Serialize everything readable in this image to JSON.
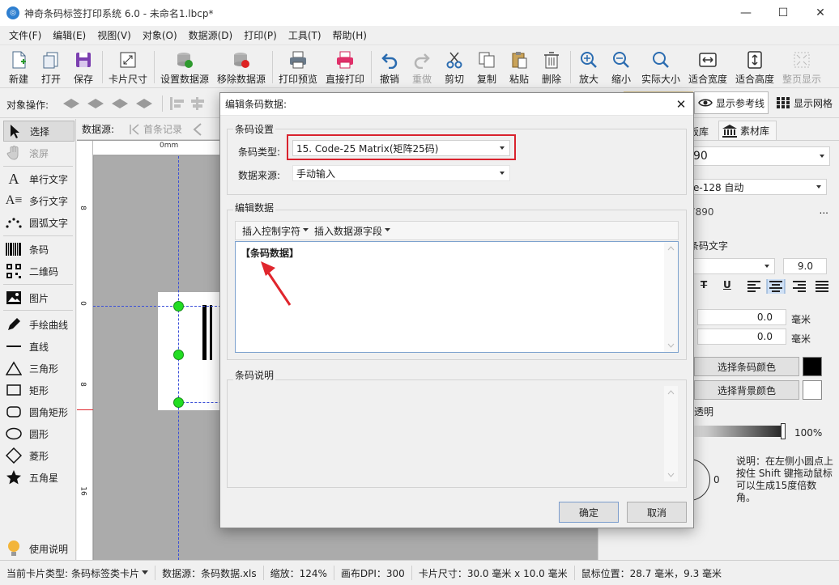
{
  "window": {
    "title": "神奇条码标签打印系统 6.0 - 未命名1.lbcp*",
    "minimize": "—",
    "maximize": "☐",
    "close": "✕"
  },
  "menu": [
    "文件(F)",
    "编辑(E)",
    "视图(V)",
    "对象(O)",
    "数据源(D)",
    "打印(P)",
    "工具(T)",
    "帮助(H)"
  ],
  "toolbar": {
    "new": "新建",
    "open": "打开",
    "save": "保存",
    "card_size": "卡片尺寸",
    "set_datasource": "设置数据源",
    "remove_datasource": "移除数据源",
    "print_preview": "打印预览",
    "direct_print": "直接打印",
    "undo": "撤销",
    "redo": "重做",
    "cut": "剪切",
    "copy": "复制",
    "paste": "粘贴",
    "delete": "删除",
    "zoom_in": "放大",
    "zoom_out": "缩小",
    "actual_size": "实际大小",
    "fit_width": "适合宽度",
    "fit_height": "适合高度",
    "fit_page": "整页显示"
  },
  "toolbar2": {
    "object_ops": "对象操作:",
    "show_guides": "显示参考线",
    "show_grid": "显示网格"
  },
  "tools": {
    "select": "选择",
    "scroll": "滚屏",
    "single_text": "单行文字",
    "multi_text": "多行文字",
    "arc_text": "圆弧文字",
    "barcode": "条码",
    "qrcode": "二维码",
    "image": "图片",
    "freehand": "手绘曲线",
    "line": "直线",
    "triangle": "三角形",
    "rect": "矩形",
    "round_rect": "圆角矩形",
    "ellipse": "圆形",
    "diamond": "菱形",
    "star": "五角星",
    "help": "使用说明"
  },
  "canvas": {
    "datasource_label": "数据源:",
    "first_record": "首条记录",
    "ruler_unit": "0mm",
    "ruler_v": [
      "8",
      "0",
      "8",
      "16"
    ]
  },
  "right_panel": {
    "tab_template": "板库",
    "tab_material": "素材库",
    "value_field": "90",
    "barcode_mode": "e-128 自动",
    "data_text": "7890",
    "more": "...",
    "barcode_text_label": "条码文字",
    "font_size": "9.0",
    "offset1": "0.0",
    "offset2": "0.0",
    "unit": "毫米",
    "bar_color_btn": "选择条码颜色",
    "bg_color_btn": "选择背景颜色",
    "transparent_label": "透明",
    "opacity": "100%",
    "rotation": "0",
    "note": "说明：在左侧小圆点上按住 Shift 键拖动鼠标可以生成15度倍数角。"
  },
  "status": {
    "card_type_label": "当前卡片类型:",
    "card_type": "条码标签类卡片",
    "datasource": "数据源：条码数据.xls",
    "zoom": "缩放：124%",
    "dpi": "画布DPI：300",
    "card_size": "卡片尺寸：30.0 毫米 x 10.0 毫米",
    "mouse_pos": "鼠标位置：28.7 毫米，9.3 毫米"
  },
  "dialog": {
    "title": "编辑条码数据:",
    "group_barcode_settings": "条码设置",
    "barcode_type_label": "条码类型:",
    "barcode_type_value": "15. Code-25 Matrix(矩阵25码)",
    "datasource_label": "数据来源:",
    "datasource_value": "手动输入",
    "group_edit_data": "编辑数据",
    "insert_control": "插入控制字符",
    "insert_field": "插入数据源字段",
    "data_content": "【条码数据】",
    "group_description": "条码说明",
    "ok": "确定",
    "cancel": "取消"
  },
  "colors": {
    "highlight_red": "#d9232e",
    "arrow_red": "#e0262d",
    "handle_green": "#22dd22",
    "guide_blue": "#3a4fd8"
  }
}
